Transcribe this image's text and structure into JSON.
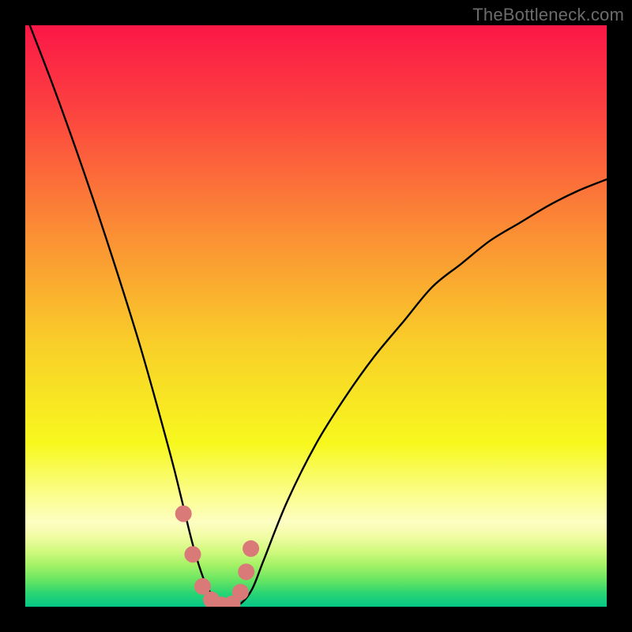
{
  "watermark": "TheBottleneck.com",
  "chart_data": {
    "type": "line",
    "title": "",
    "xlabel": "",
    "ylabel": "",
    "xlim": [
      0,
      100
    ],
    "ylim": [
      0,
      100
    ],
    "series": [
      {
        "name": "bottleneck-curve",
        "x": [
          0,
          5,
          10,
          15,
          20,
          25,
          27,
          29,
          31,
          33,
          35,
          37,
          39,
          41,
          45,
          50,
          55,
          60,
          65,
          70,
          75,
          80,
          85,
          90,
          95,
          100
        ],
        "y": [
          102,
          89,
          75,
          60,
          44,
          26,
          18,
          10,
          4,
          1,
          0,
          0.5,
          3,
          8,
          18,
          28,
          36,
          43,
          49,
          55,
          59,
          63,
          66,
          69,
          71.5,
          73.5
        ]
      }
    ],
    "markers": {
      "name": "data-points",
      "color": "#d97a78",
      "x": [
        27.2,
        28.8,
        30.5,
        32.0,
        33.8,
        35.6,
        37.0,
        38.0,
        38.8
      ],
      "y": [
        16.0,
        9.0,
        3.5,
        1.2,
        0.3,
        0.5,
        2.5,
        6.0,
        10.0
      ]
    },
    "background": {
      "type": "vertical-gradient",
      "stops": [
        {
          "pos": 0.0,
          "color": "#fb1747"
        },
        {
          "pos": 0.14,
          "color": "#fc4040"
        },
        {
          "pos": 0.35,
          "color": "#fb8c35"
        },
        {
          "pos": 0.55,
          "color": "#f9cf29"
        },
        {
          "pos": 0.72,
          "color": "#f7f81e"
        },
        {
          "pos": 0.8,
          "color": "#fbfd84"
        },
        {
          "pos": 0.855,
          "color": "#fdfec2"
        },
        {
          "pos": 0.88,
          "color": "#f0fca3"
        },
        {
          "pos": 0.905,
          "color": "#d0f97e"
        },
        {
          "pos": 0.928,
          "color": "#a5f266"
        },
        {
          "pos": 0.955,
          "color": "#66e562"
        },
        {
          "pos": 0.978,
          "color": "#27d474"
        },
        {
          "pos": 1.0,
          "color": "#06c786"
        }
      ]
    }
  }
}
